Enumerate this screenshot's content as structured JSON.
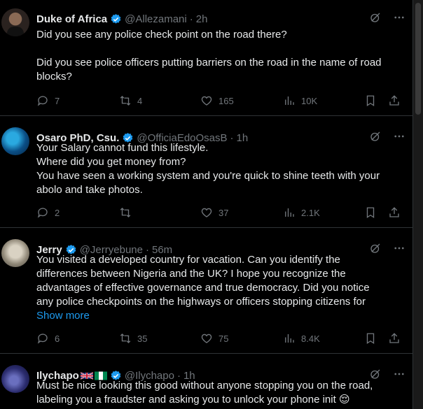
{
  "tweets": [
    {
      "name": "Duke of Africa",
      "handle": "@Allezamani",
      "time": "2h",
      "lines": [
        "Did you see any police check point on the road there?",
        "",
        "Did you see police officers putting barriers on the road in the name of road",
        "blocks?"
      ],
      "replies": "7",
      "retweets": "4",
      "likes": "165",
      "views": "10K"
    },
    {
      "name": "Osaro PhD, Csu.",
      "handle": "@OfficiaEdoOsasB",
      "time": "1h",
      "lines": [
        "Your Salary cannot fund this lifestyle.",
        "Where did you get money from?",
        "You have seen a working system and you're quick to shine teeth with your",
        "abolo and take photos."
      ],
      "replies": "2",
      "retweets": "",
      "likes": "37",
      "views": "2.1K"
    },
    {
      "name": "Jerry",
      "handle": "@Jerryebune",
      "time": "56m",
      "lines": [
        "You visited a developed country for vacation. Can you identify the",
        "differences between Nigeria and the UK? I hope you recognize the",
        "advantages of effective governance and true democracy. Did you notice",
        "any police checkpoints on the highways or officers stopping citizens for"
      ],
      "show_more": "Show more",
      "replies": "6",
      "retweets": "35",
      "likes": "75",
      "views": "8.4K"
    },
    {
      "name": "Ilychapo",
      "handle": "@Ilychapo",
      "time": "1h",
      "lines": [
        "Must be nice looking this good without anyone stopping you on the road,",
        "labeling you a fraudster and asking you to unlock your phone init 😌"
      ]
    }
  ],
  "separator": "·",
  "colors": {
    "background": "#000000",
    "text": "#e7e9ea",
    "muted": "#71767b",
    "accent": "#1d9bf0",
    "border": "#2f3336"
  }
}
